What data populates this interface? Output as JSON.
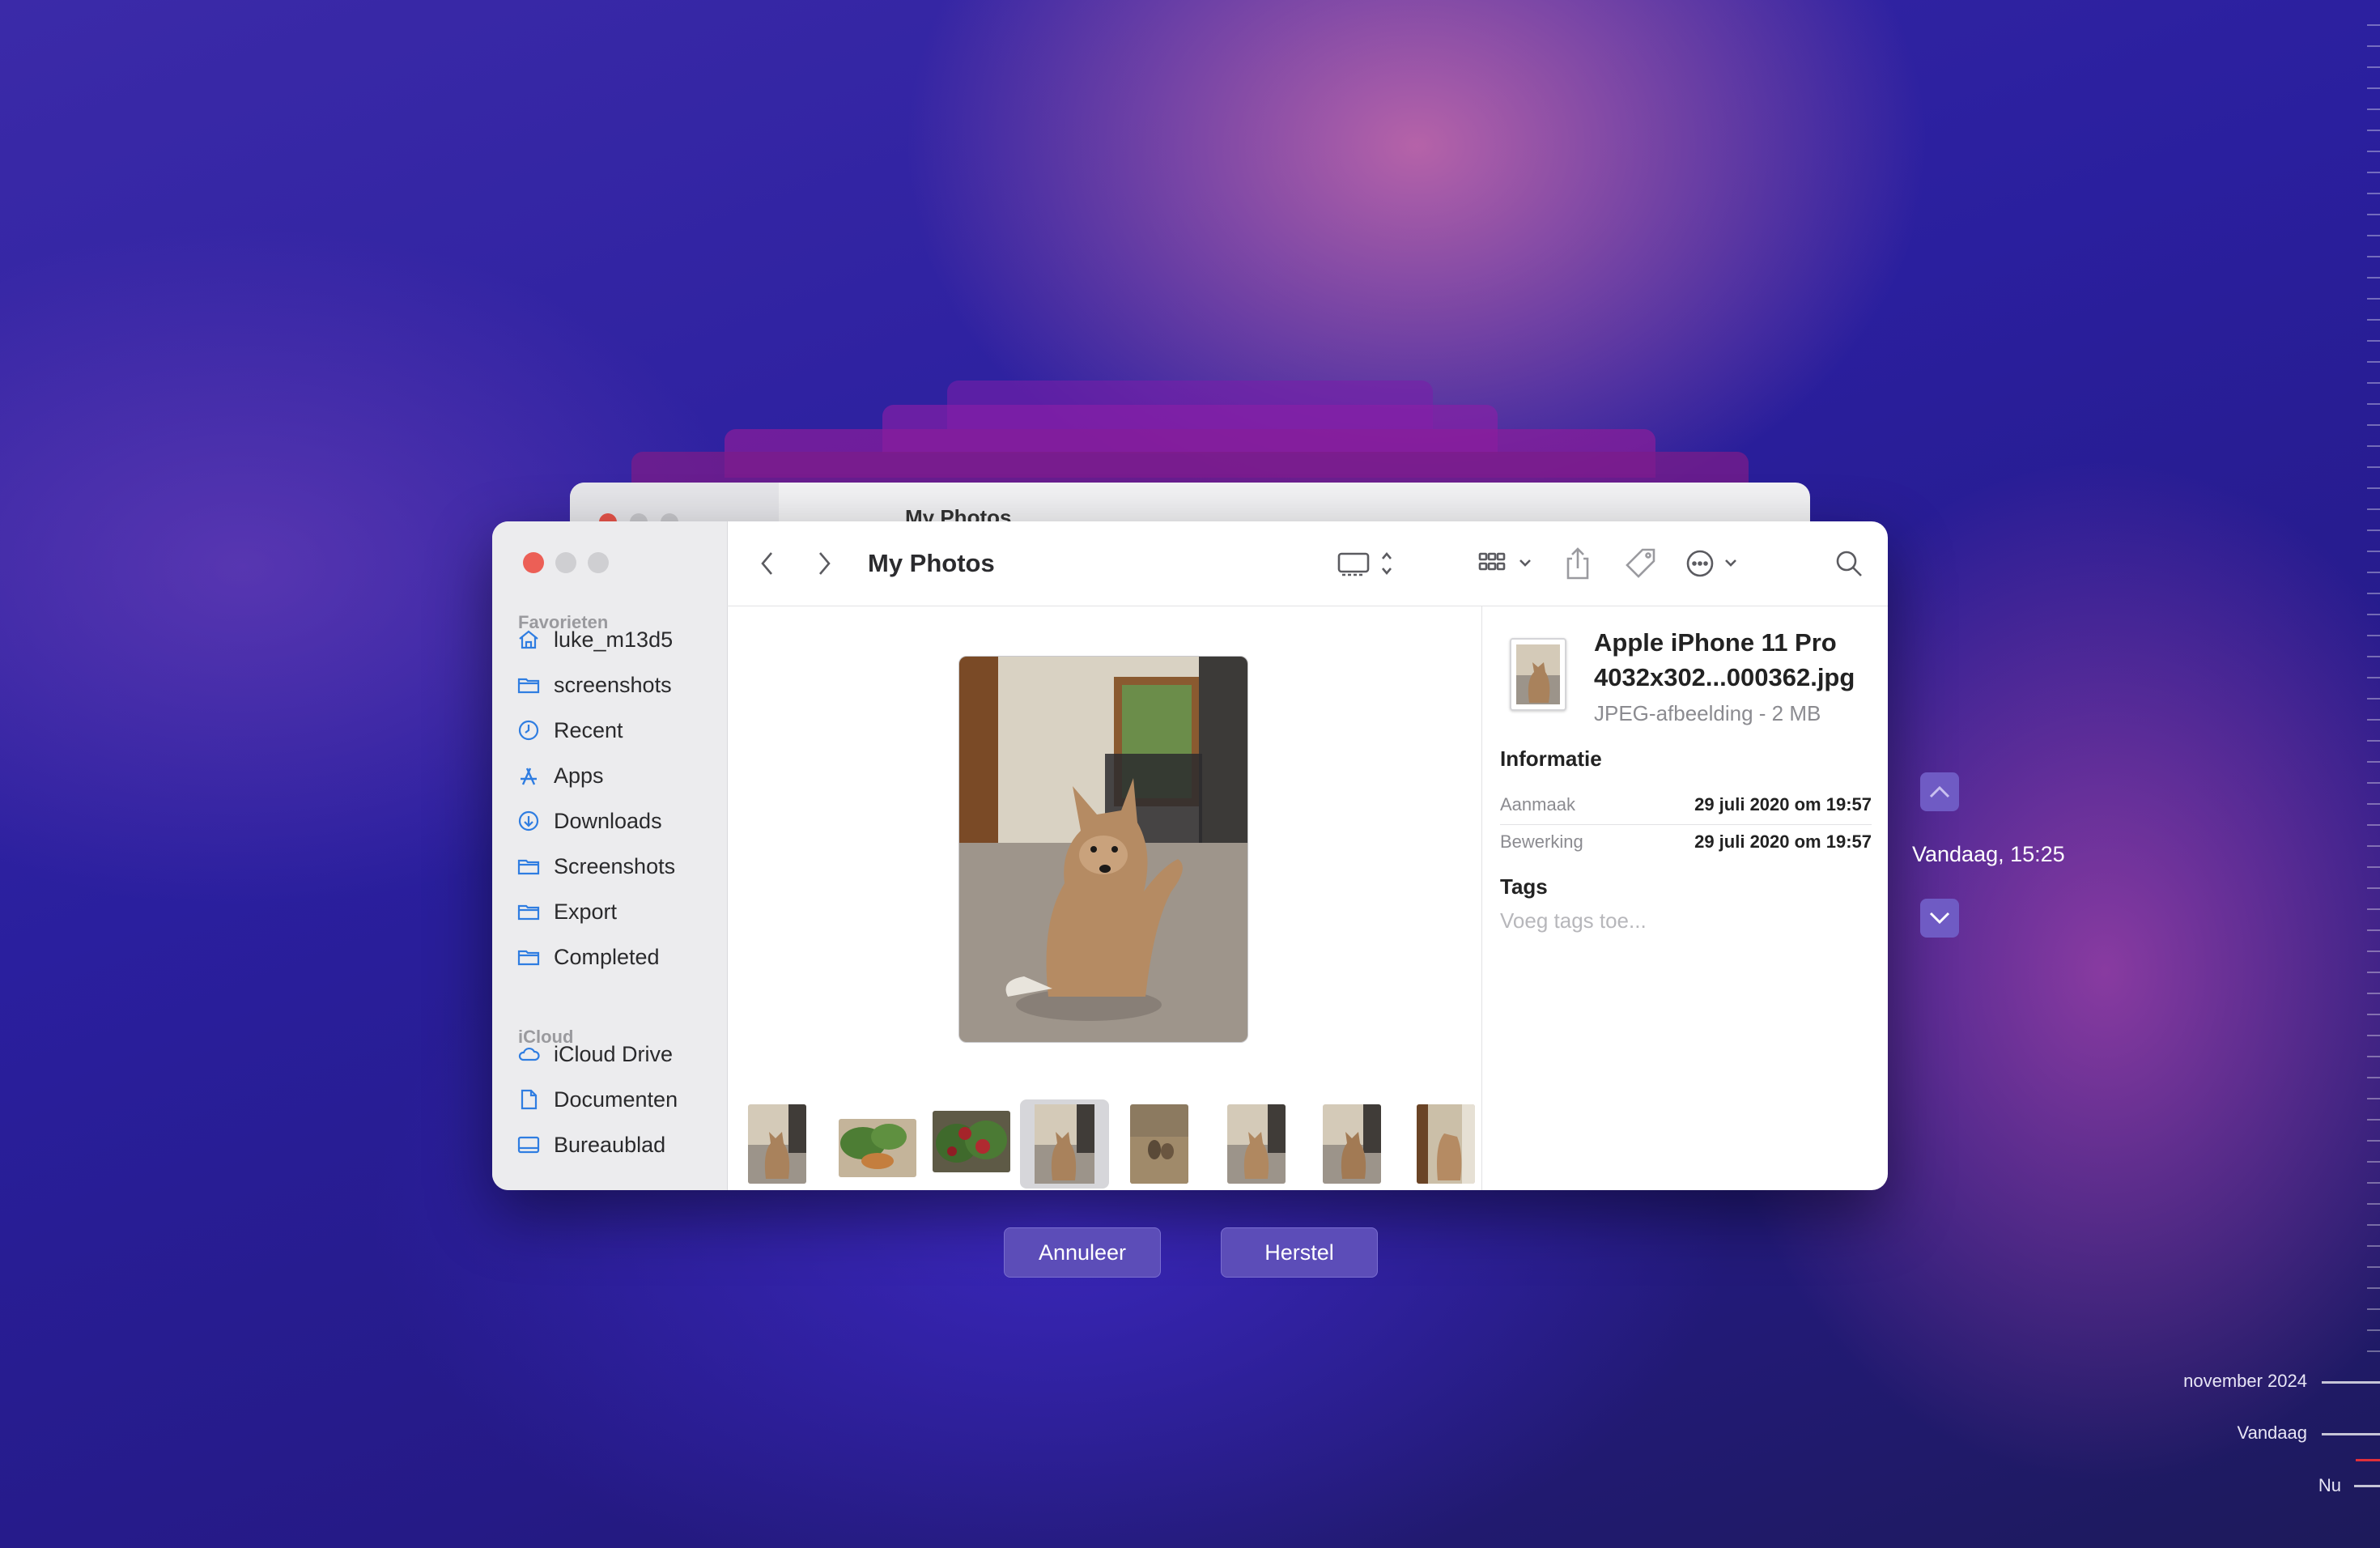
{
  "window": {
    "title": "My Photos",
    "background_window_title": "My Photos"
  },
  "sidebar": {
    "favorites_header": "Favorieten",
    "favorites": [
      {
        "label": "luke_m13d5",
        "icon": "home-icon"
      },
      {
        "label": "screenshots",
        "icon": "folder-icon"
      },
      {
        "label": "Recent",
        "icon": "clock-icon"
      },
      {
        "label": "Apps",
        "icon": "apps-icon"
      },
      {
        "label": "Downloads",
        "icon": "download-icon"
      },
      {
        "label": "Screenshots",
        "icon": "folder-icon"
      },
      {
        "label": "Export",
        "icon": "folder-icon"
      },
      {
        "label": "Completed",
        "icon": "folder-icon"
      }
    ],
    "icloud_header": "iCloud",
    "icloud": [
      {
        "label": "iCloud Drive",
        "icon": "cloud-icon"
      },
      {
        "label": "Documenten",
        "icon": "document-icon"
      },
      {
        "label": "Bureaublad",
        "icon": "desktop-icon"
      }
    ]
  },
  "info": {
    "file_name": "Apple iPhone 11 Pro 4032x302...000362.jpg",
    "file_type": "JPEG-afbeelding - 2 MB",
    "section_title": "Informatie",
    "rows": [
      {
        "key": "Aanmaak",
        "value": "29 juli 2020 om 19:57"
      },
      {
        "key": "Bewerking",
        "value": "29 juli 2020 om 19:57"
      }
    ],
    "tags_title": "Tags",
    "tags_placeholder": "Voeg tags toe..."
  },
  "buttons": {
    "cancel": "Annuleer",
    "restore": "Herstel"
  },
  "time_machine": {
    "current_time": "Vandaag, 15:25",
    "timeline_labels": [
      "november 2024",
      "Vandaag",
      "Nu"
    ]
  },
  "colors": {
    "accent": "#2f7de1",
    "close": "#ec5f56",
    "button_bg": "#5c4db8"
  }
}
